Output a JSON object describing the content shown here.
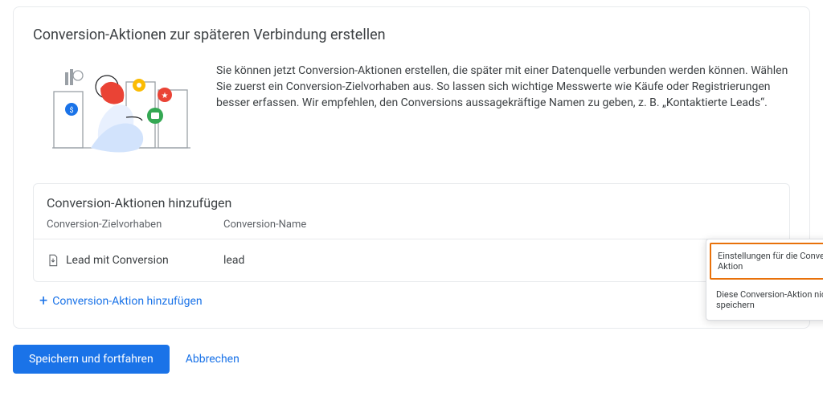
{
  "card": {
    "title": "Conversion-Aktionen zur späteren Verbindung erstellen",
    "description": "Sie können jetzt Conversion-Aktionen erstellen, die später mit einer Datenquelle verbunden werden können. Wählen Sie zuerst ein Conversion-Zielvorhaben aus. So lassen sich wichtige Messwerte wie Käufe oder Registrierungen besser erfassen. Wir empfehlen, den Conversions aussagekräftige Namen zu geben, z. B. „Kontaktierte Leads“."
  },
  "table": {
    "heading": "Conversion-Aktionen hinzufügen",
    "columns": {
      "goal": "Conversion-Zielvorhaben",
      "name": "Conversion-Name"
    },
    "row": {
      "goal": "Lead mit Conversion",
      "name": "lead",
      "actionPartial": "Einst"
    }
  },
  "add_link": "Conversion-Aktion hinzufügen",
  "popover": {
    "settings": "Einstellungen für die Conversion-Aktion",
    "discard": "Diese Conversion-Aktion nicht speichern"
  },
  "buttons": {
    "save": "Speichern und fortfahren",
    "cancel": "Abbrechen"
  }
}
